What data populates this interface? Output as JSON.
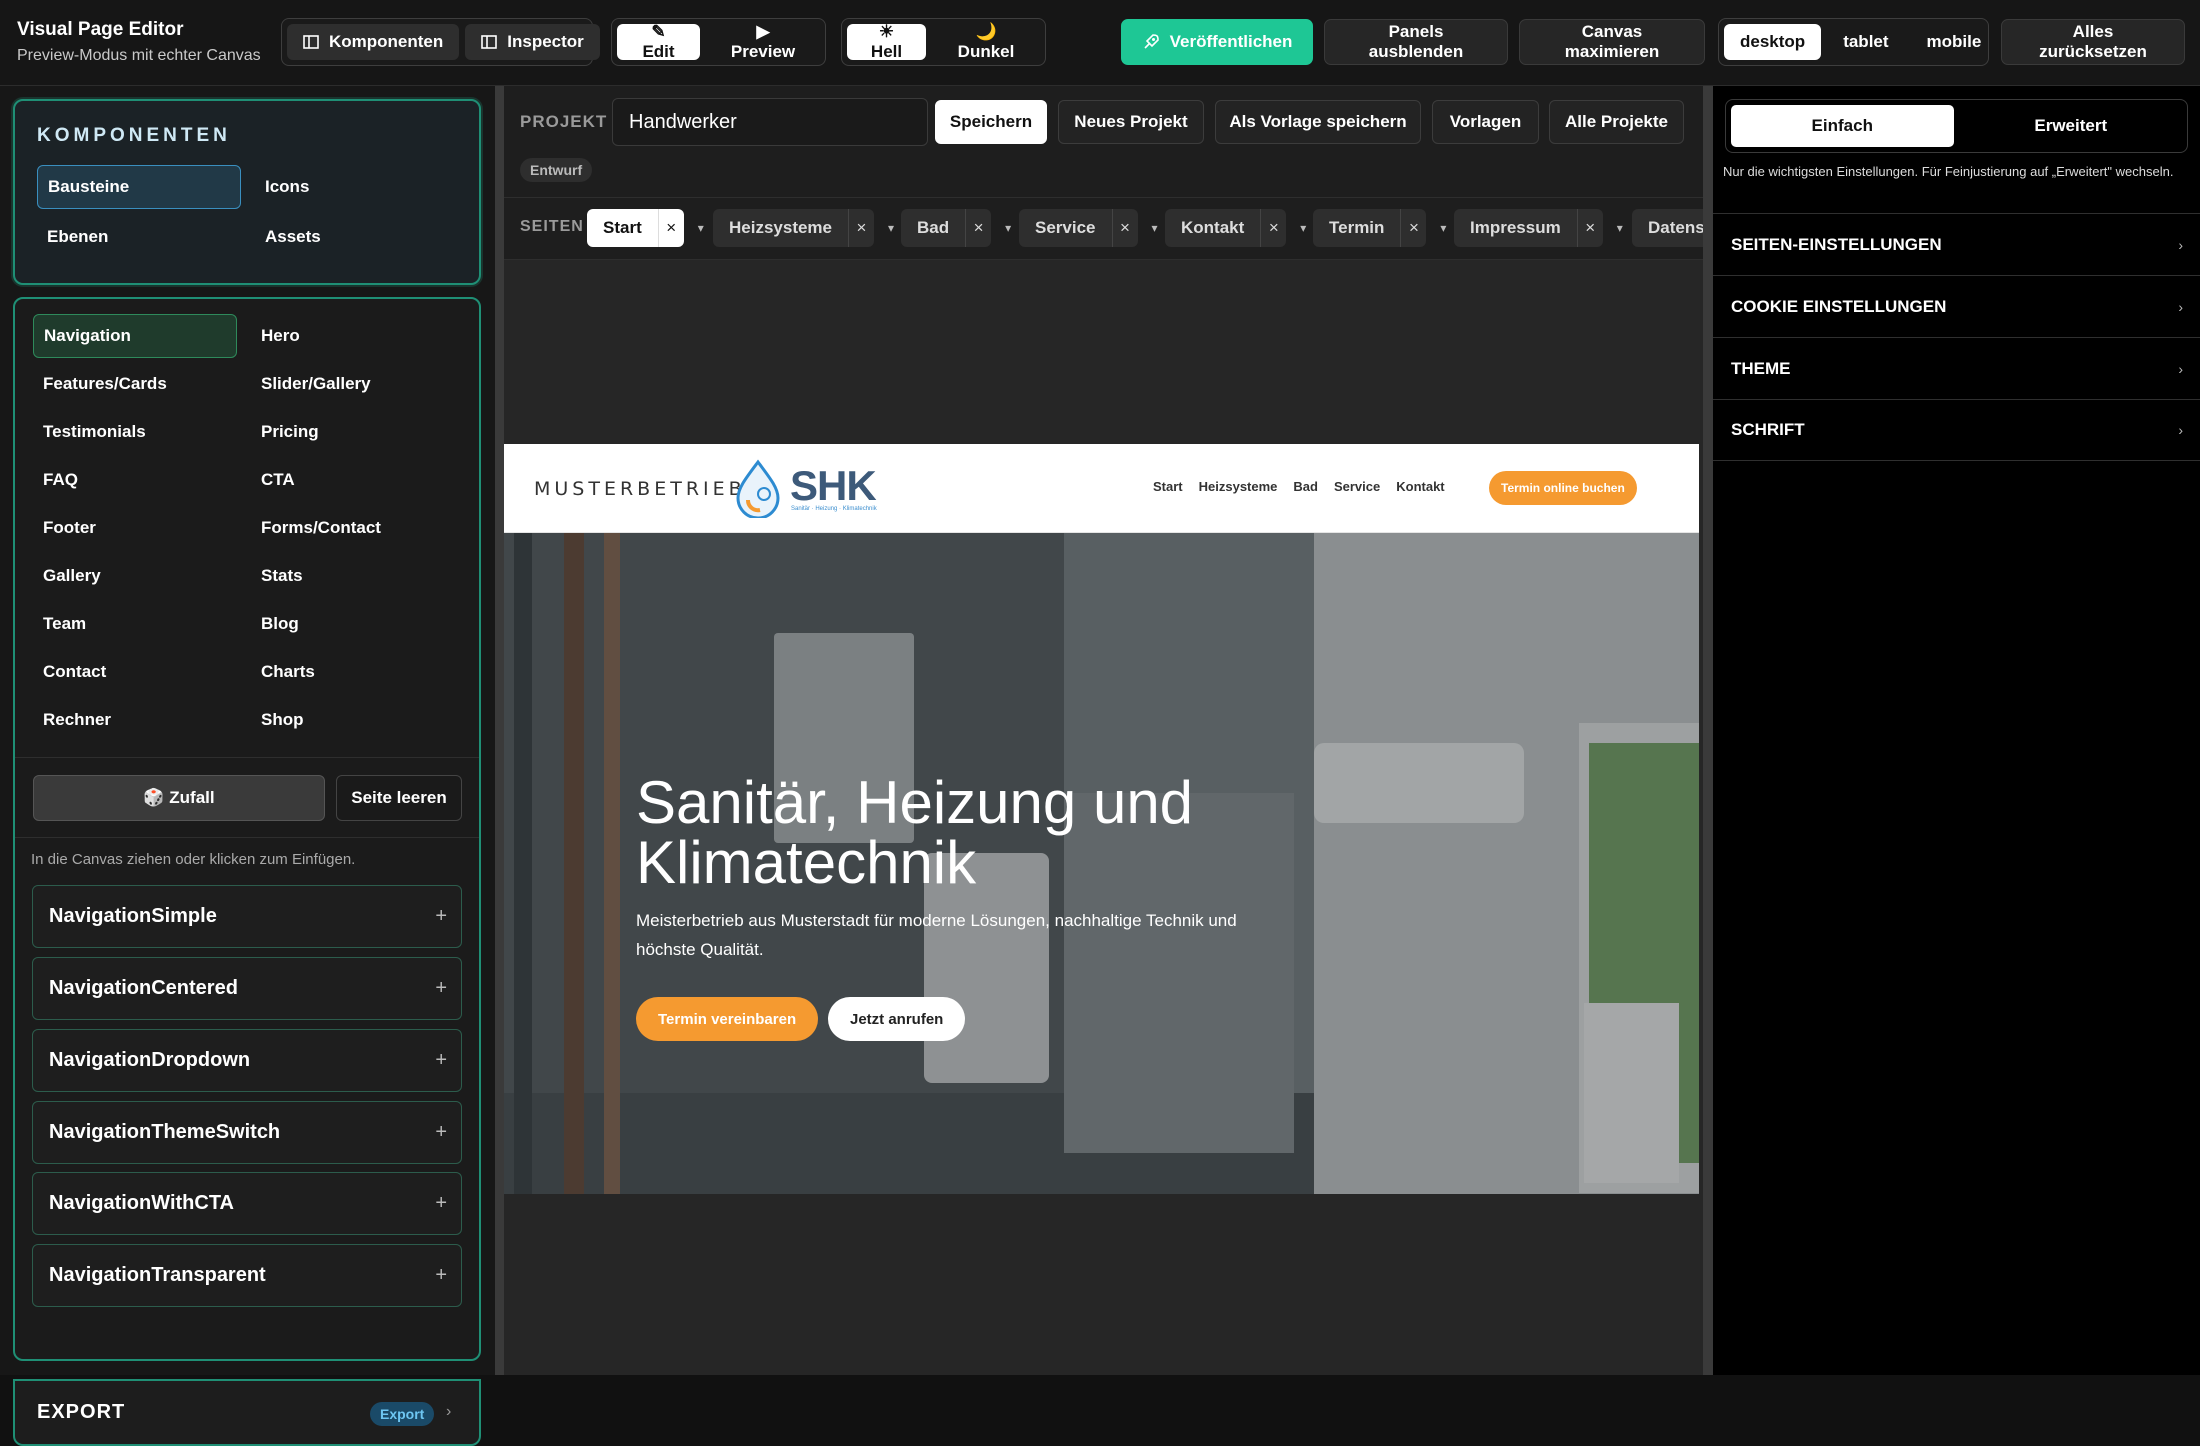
{
  "app": {
    "title": "Visual Page Editor",
    "subtitle": "Preview-Modus mit echter Canvas"
  },
  "toolbar": {
    "panels": [
      "Komponenten",
      "Inspector"
    ],
    "mode": [
      "✎ Edit",
      "▶ Preview"
    ],
    "theme": [
      "☀ Hell",
      "🌙 Dunkel"
    ],
    "publish": "Veröffentlichen",
    "hide_panels": "Panels ausblenden",
    "maximize": "Canvas maximieren",
    "devices": [
      "desktop",
      "tablet",
      "mobile"
    ],
    "reset": "Alles zurücksetzen",
    "accent": "#1ec795"
  },
  "left": {
    "heading": "KOMPONENTEN",
    "tabs": [
      "Bausteine",
      "Icons",
      "Ebenen",
      "Assets"
    ],
    "categories": [
      "Navigation",
      "Hero",
      "Features/Cards",
      "Slider/Gallery",
      "Testimonials",
      "Pricing",
      "FAQ",
      "CTA",
      "Footer",
      "Forms/Contact",
      "Gallery",
      "Stats",
      "Team",
      "Blog",
      "Contact",
      "Charts",
      "Rechner",
      "Shop"
    ],
    "random": "🎲 Zufall",
    "clear": "Seite leeren",
    "hint": "In die Canvas ziehen oder klicken zum Einfügen.",
    "components": [
      "NavigationSimple",
      "NavigationCentered",
      "NavigationDropdown",
      "NavigationThemeSwitch",
      "NavigationWithCTA",
      "NavigationTransparent"
    ],
    "plus": "+",
    "export": {
      "title": "EXPORT",
      "badge": "Export",
      "chevron": "›"
    }
  },
  "project": {
    "label": "PROJEKT",
    "name": "Handwerker",
    "buttons": [
      "Speichern",
      "Neues Projekt",
      "Als Vorlage speichern",
      "Vorlagen",
      "Alle Projekte"
    ],
    "status": "Entwurf"
  },
  "pages": {
    "label": "SEITEN",
    "tabs": [
      "Start",
      "Heizsysteme",
      "Bad",
      "Service",
      "Kontakt",
      "Termin",
      "Impressum",
      "Datens"
    ],
    "close": "×",
    "caret": "▾"
  },
  "preview": {
    "logo_text": "MUSTERBETRIEB",
    "logo_mark": "SHK",
    "logo_sub": "Sanitär · Heizung · Klimatechnik",
    "nav": [
      "Start",
      "Heizsysteme",
      "Bad",
      "Service",
      "Kontakt"
    ],
    "nav_cta": "Termin online buchen",
    "hero_title": "Sanitär, Heizung und Klimatechnik",
    "hero_text": "Meisterbetrieb aus Musterstadt für moderne Lösungen, nachhaltige Technik und höchste Qualität.",
    "cta_primary": "Termin vereinbaren",
    "cta_secondary": "Jetzt anrufen",
    "brand_color": "#f59a30"
  },
  "inspector": {
    "tabs": [
      "Einfach",
      "Erweitert"
    ],
    "hint": "Nur die wichtigsten Einstellungen. Für Feinjustierung auf „Erweitert\" wechseln.",
    "sections": [
      "SEITEN-EINSTELLUNGEN",
      "COOKIE EINSTELLUNGEN",
      "THEME",
      "SCHRIFT"
    ],
    "chevron": "›"
  }
}
